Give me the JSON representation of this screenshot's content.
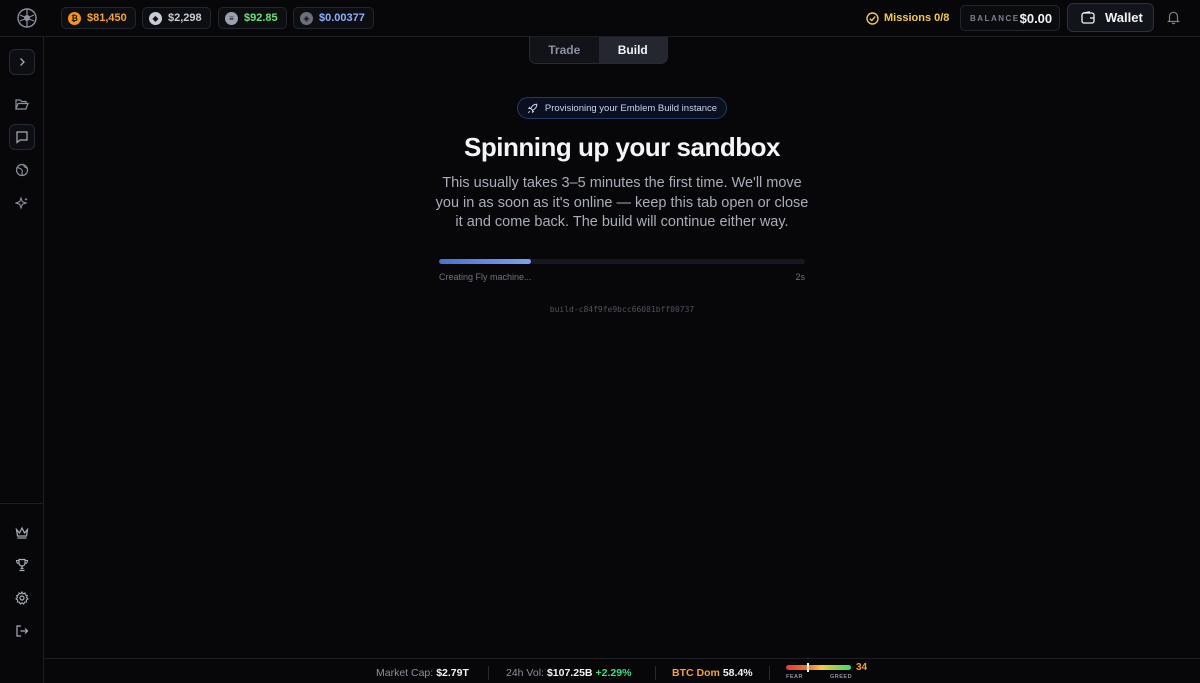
{
  "topbar": {
    "tickers": [
      {
        "symbol": "BTC",
        "coin_glyph": "₿",
        "price": "$81,450",
        "color": "#f7931a",
        "text_color": "#f2a33a"
      },
      {
        "symbol": "ETH",
        "coin_glyph": "◆",
        "price": "$2,298",
        "color": "#c9ccd6",
        "text_color": "#c9ccd6"
      },
      {
        "symbol": "SOL",
        "coin_glyph": "≡",
        "price": "$92.85",
        "color": "#9aa0ad",
        "text_color": "#6ee07a"
      },
      {
        "symbol": "EMBLEM",
        "coin_glyph": "◈",
        "price": "$0.00377",
        "color": "#6b6f7c",
        "text_color": "#8fb0ff"
      }
    ],
    "missions_label": "Missions 0/8",
    "balance_label": "BALANCE",
    "balance_value": "$0.00",
    "wallet_label": "Wallet"
  },
  "mode_tabs": [
    {
      "label": "Trade",
      "active": false
    },
    {
      "label": "Build",
      "active": true
    }
  ],
  "main": {
    "pill_text": "Provisioning your Emblem Build instance",
    "headline": "Spinning up your sandbox",
    "description": "This usually takes 3–5 minutes the first time. We'll move you in as soon as it's online — keep this tab open or close it and come back. The build will continue either way.",
    "progress_fraction": 0.25,
    "progress_status": "Creating Fly machine...",
    "elapsed": "2s",
    "build_id": "build-c84f9fe9bcc66081bff00737"
  },
  "footer": {
    "market_cap_label": "Market Cap:",
    "market_cap_value": "$2.79T",
    "vol_label": "24h Vol:",
    "vol_value": "$107.25B",
    "vol_change": "+2.29%",
    "btc_dom_label": "BTC Dom",
    "btc_dom_value": "58.4%",
    "fear_label": "FEAR",
    "greed_label": "GREED",
    "fear_greed_value": "34",
    "fear_greed_index": 34
  }
}
